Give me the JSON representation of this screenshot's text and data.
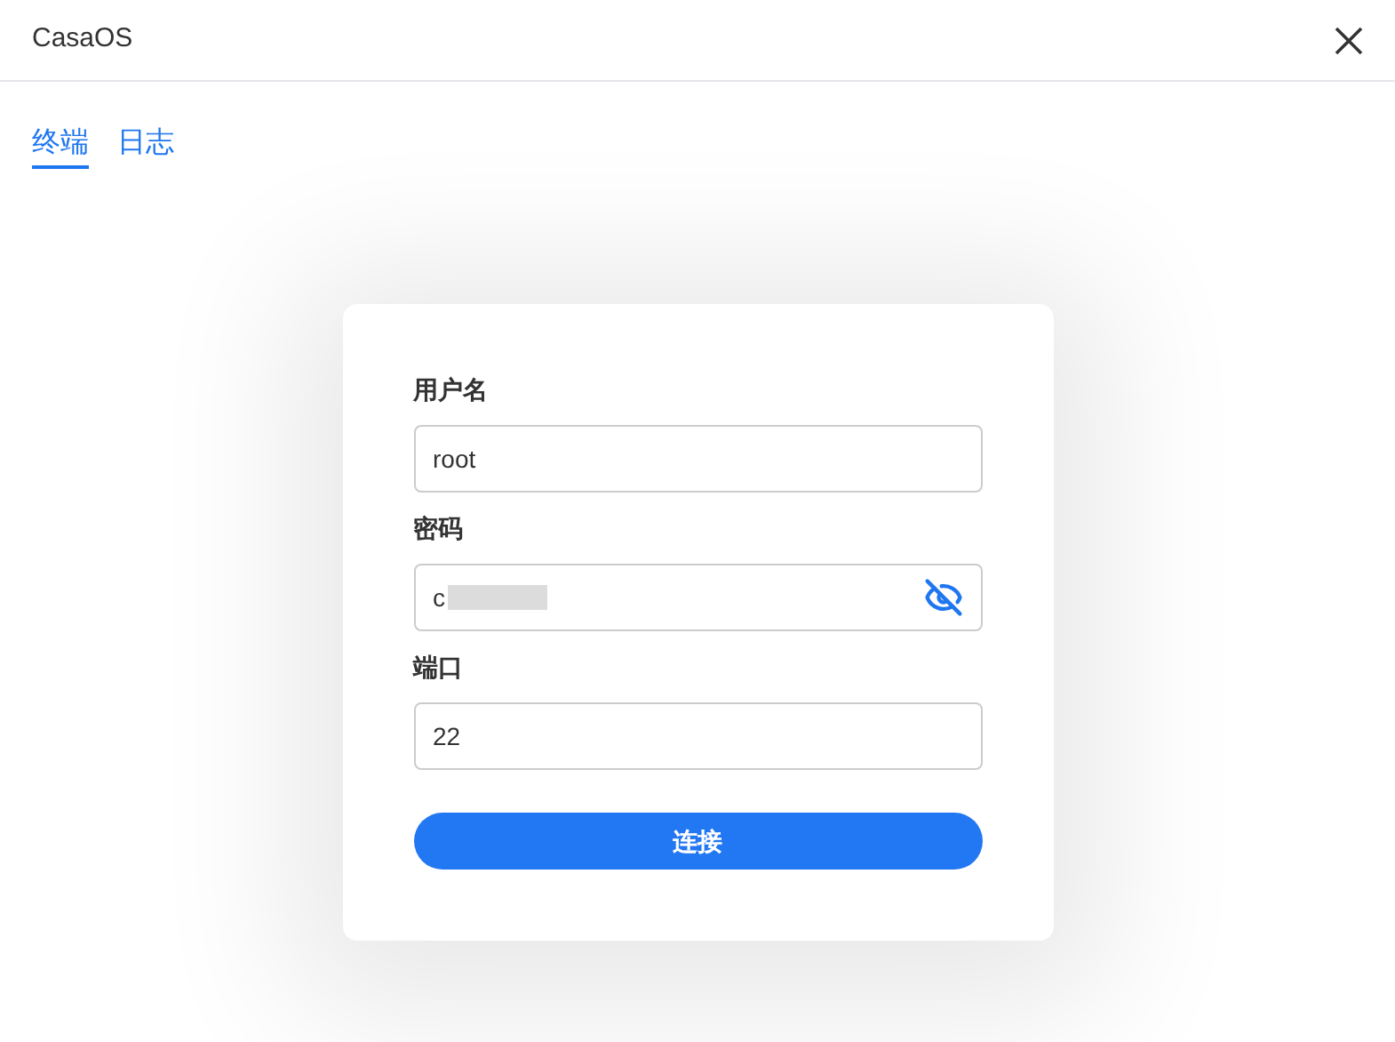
{
  "window": {
    "title": "CasaOS"
  },
  "tabs": [
    {
      "label": "终端",
      "selected": true
    },
    {
      "label": "日志",
      "selected": false
    }
  ],
  "form": {
    "fields": [
      {
        "kind": "text",
        "label": "用户名",
        "value": "root"
      },
      {
        "kind": "password",
        "label": "密码",
        "value": "c"
      },
      {
        "kind": "text",
        "label": "端口",
        "value": "22"
      }
    ],
    "button": "连接"
  }
}
